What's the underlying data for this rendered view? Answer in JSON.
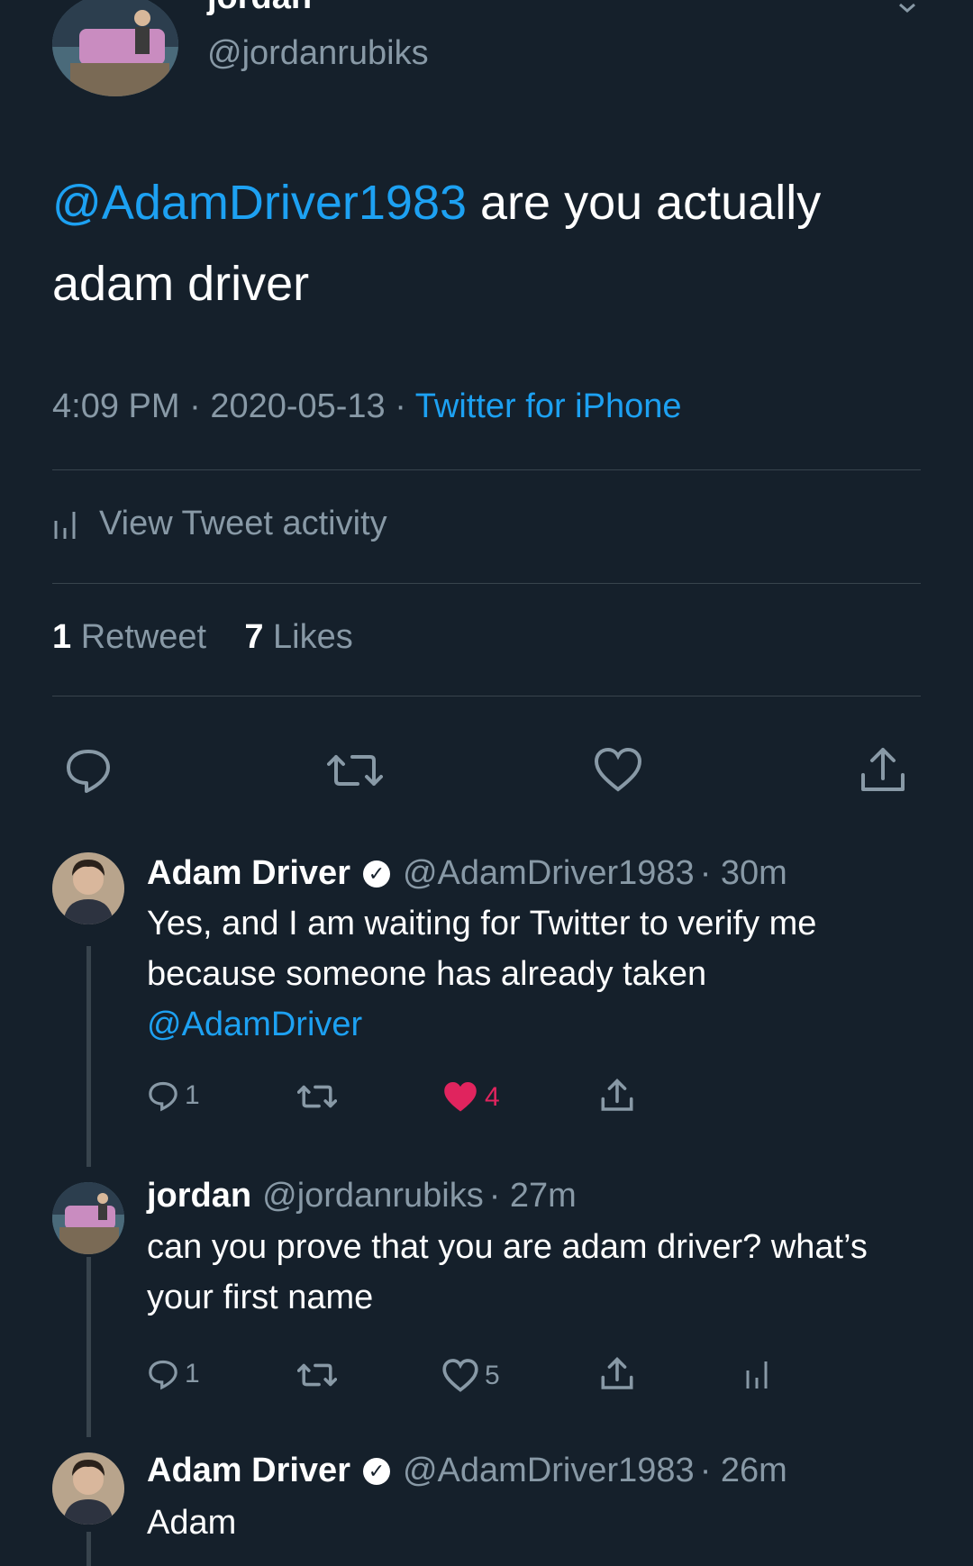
{
  "tweet": {
    "author_name": "jordan",
    "author_handle": "@jordanrubiks",
    "mention": "@AdamDriver1983",
    "text_rest": " are you actually adam driver",
    "time": "4:09 PM",
    "date": "2020-05-13",
    "sep": "·",
    "client": "Twitter for iPhone",
    "activity_label": "View Tweet activity",
    "retweet_count": "1",
    "retweet_label": "Retweet",
    "like_count": "7",
    "like_label": "Likes"
  },
  "replies": [
    {
      "name": "Adam Driver",
      "verified": true,
      "handle": "@AdamDriver1983",
      "time": "· 30m",
      "text": "Yes, and I am waiting for Twitter to verify me because someone has already taken ",
      "mention": "@AdamDriver",
      "reply_count": "1",
      "like_count": "4",
      "liked": true
    },
    {
      "name": "jordan",
      "verified": false,
      "handle": "@jordanrubiks",
      "time": "· 27m",
      "text": "can you prove that you are adam driver? what’s your first name",
      "reply_count": "1",
      "like_count": "5",
      "liked": false
    },
    {
      "name": "Adam Driver",
      "verified": true,
      "handle": "@AdamDriver1983",
      "time": "· 26m",
      "text": "Adam"
    }
  ],
  "icons": {
    "reply": "reply-icon",
    "retweet": "retweet-icon",
    "like": "heart-icon",
    "share": "share-icon",
    "analytics": "analytics-icon",
    "verified": "verified-badge-icon",
    "caret": "chevron-down-icon"
  },
  "colors": {
    "background": "#15202b",
    "link": "#1da1f2",
    "muted": "#8899a6",
    "liked": "#e0245e",
    "divider": "#38444d"
  }
}
